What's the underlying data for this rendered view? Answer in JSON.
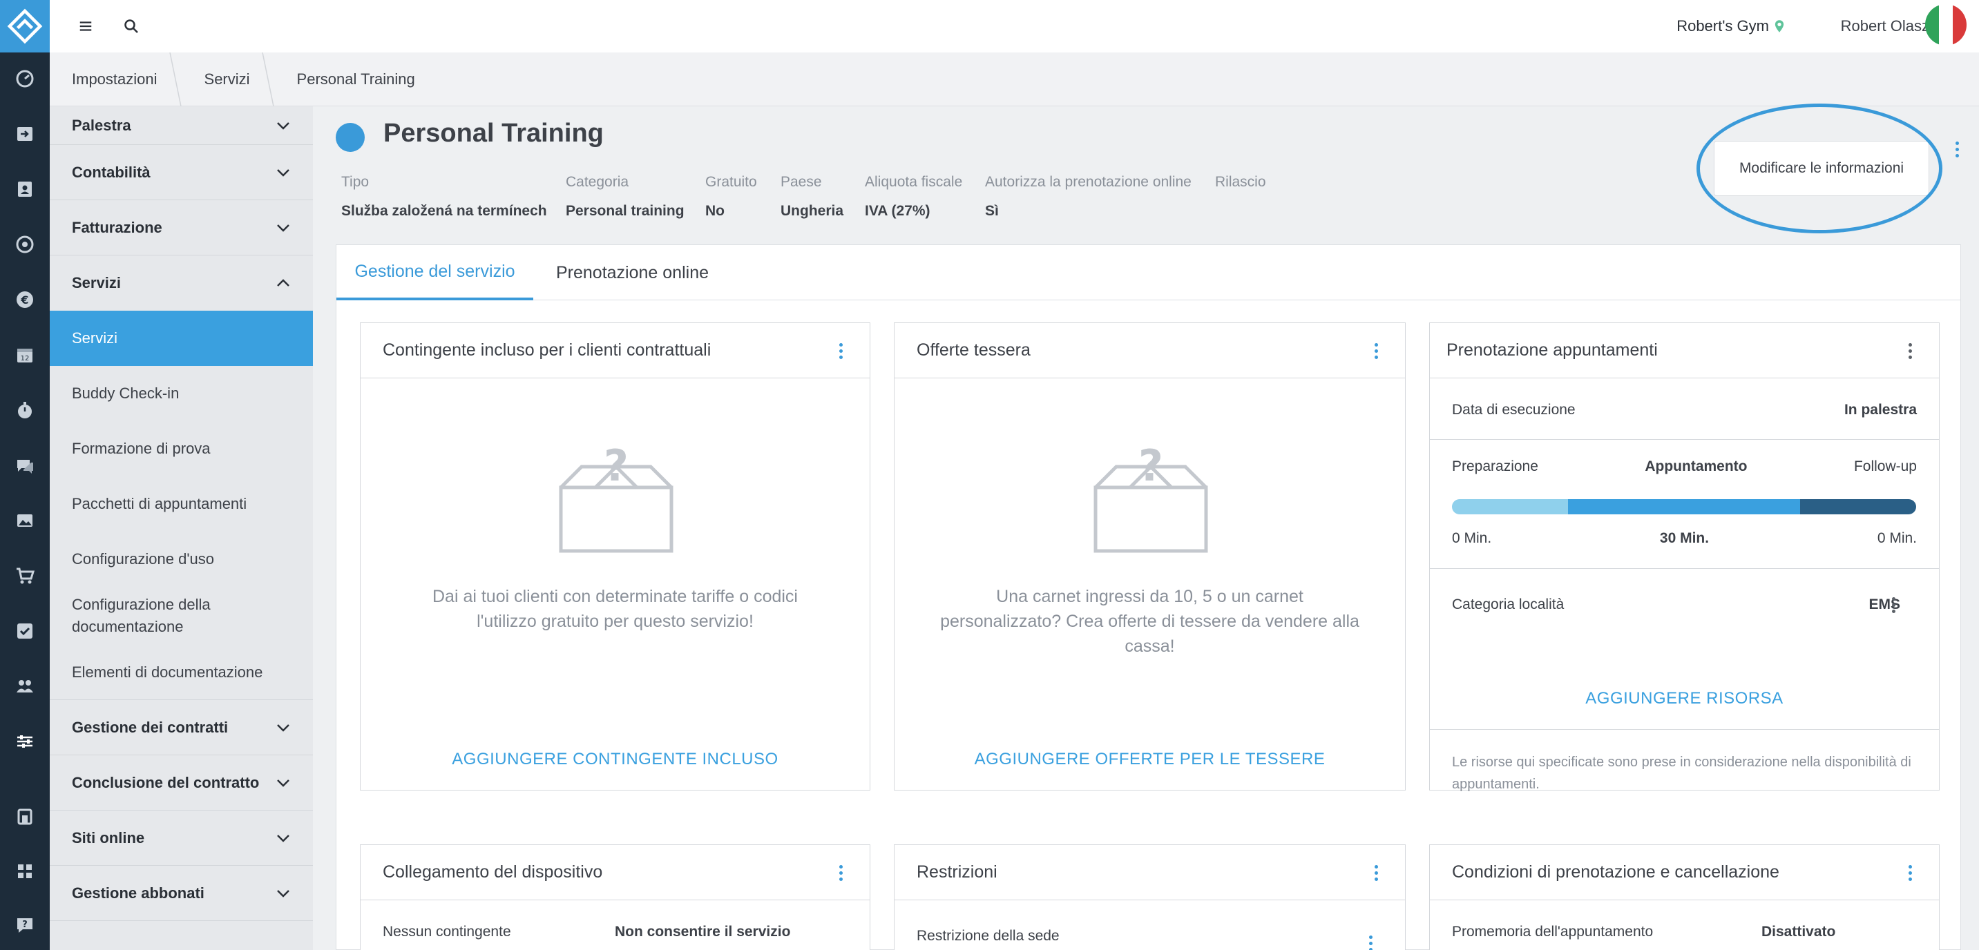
{
  "topbar": {
    "gym_name": "Robert's Gym",
    "user_name": "Robert Olasz"
  },
  "breadcrumb": [
    "Impostazioni",
    "Servizi",
    "Personal Training"
  ],
  "sidebar": {
    "sections_top": [
      {
        "label": "Palestra"
      },
      {
        "label": "Contabilità"
      },
      {
        "label": "Fatturazione"
      },
      {
        "label": "Servizi"
      }
    ],
    "servizi_items": [
      {
        "label": "Servizi",
        "active": true
      },
      {
        "label": "Buddy Check-in"
      },
      {
        "label": "Formazione di prova"
      },
      {
        "label": "Pacchetti di appuntamenti"
      },
      {
        "label": "Configurazione d'uso"
      },
      {
        "label": "Configurazione della documentazione"
      },
      {
        "label": "Elementi di documentazione"
      }
    ],
    "sections_bottom": [
      {
        "label": "Gestione dei contratti"
      },
      {
        "label": "Conclusione del contratto"
      },
      {
        "label": "Siti online"
      },
      {
        "label": "Gestione abbonati"
      }
    ]
  },
  "service": {
    "title": "Personal Training",
    "color": "#3a9ad9",
    "meta": [
      {
        "key": "Tipo",
        "value": "Služba založená na termínech"
      },
      {
        "key": "Categoria",
        "value": "Personal training"
      },
      {
        "key": "Gratuito",
        "value": "No"
      },
      {
        "key": "Paese",
        "value": "Ungheria"
      },
      {
        "key": "Aliquota fiscale",
        "value": "IVA (27%)"
      },
      {
        "key": "Autorizza la prenotazione online",
        "value": "Sì"
      },
      {
        "key": "Rilascio",
        "value": ""
      }
    ],
    "edit_button": "Modificare le informazioni"
  },
  "tabs": [
    {
      "label": "Gestione del servizio",
      "active": true
    },
    {
      "label": "Prenotazione online",
      "active": false
    }
  ],
  "cards": {
    "contingente": {
      "title": "Contingente incluso per i clienti contrattuali",
      "empty_text": "Dai ai tuoi clienti con determinate tariffe o codici l'utilizzo gratuito per questo servizio!",
      "action": "AGGIUNGERE CONTINGENTE INCLUSO"
    },
    "tessera": {
      "title": "Offerte tessera",
      "empty_text": "Una carnet ingressi da 10, 5 o un carnet personalizzato? Crea offerte di tessere da vendere alla cassa!",
      "action": "AGGIUNGERE OFFERTE PER LE TESSERE"
    },
    "prenotazione": {
      "title": "Prenotazione appuntamenti",
      "exec_label": "Data di esecuzione",
      "exec_value": "In palestra",
      "phases": [
        "Preparazione",
        "Appuntamento",
        "Follow-up"
      ],
      "durations": [
        "0 Min.",
        "30 Min.",
        "0 Min."
      ],
      "bar_fractions": [
        0.25,
        0.5,
        0.25
      ],
      "bar_colors": [
        "#8fd0ec",
        "#3aa0df",
        "#2a5f86"
      ],
      "category_label": "Categoria località",
      "category_value": "EMS",
      "action": "AGGIUNGERE RISORSA",
      "note": "Le risorse qui specificate sono prese in considerazione nella disponibilità di appuntamenti."
    },
    "dispositivo": {
      "title": "Collegamento del dispositivo",
      "row_label": "Nessun contingente",
      "row_value": "Non consentire il servizio"
    },
    "restrizioni": {
      "title": "Restrizioni",
      "row_label": "Restrizione della sede"
    },
    "condizioni": {
      "title": "Condizioni di prenotazione e cancellazione",
      "row_label": "Promemoria dell'appuntamento",
      "row_value": "Disattivato"
    }
  }
}
